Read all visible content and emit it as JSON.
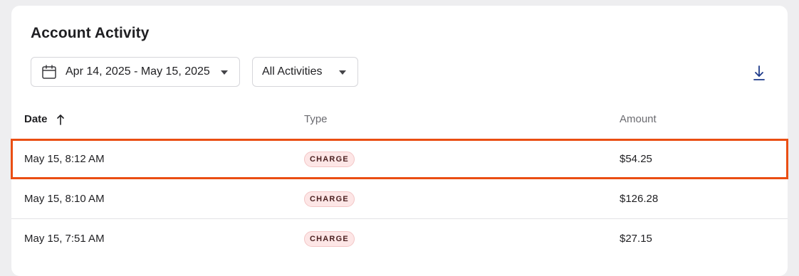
{
  "page": {
    "title": "Account Activity"
  },
  "filters": {
    "date_range": "Apr 14, 2025 - May 15, 2025",
    "activity_type": "All Activities"
  },
  "icons": {
    "calendar": "calendar-icon",
    "caret": "chevron-down-icon",
    "download": "download-icon",
    "sort": "arrow-up-icon"
  },
  "table": {
    "headers": {
      "date": "Date",
      "type": "Type",
      "amount": "Amount"
    },
    "sort": {
      "column": "date",
      "direction": "ascending"
    },
    "rows": [
      {
        "date": "May 15, 8:12 AM",
        "type": "CHARGE",
        "amount": "$54.25",
        "highlighted": true
      },
      {
        "date": "May 15, 8:10 AM",
        "type": "CHARGE",
        "amount": "$126.28",
        "highlighted": false
      },
      {
        "date": "May 15, 7:51 AM",
        "type": "CHARGE",
        "amount": "$27.15",
        "highlighted": false
      }
    ]
  },
  "colors": {
    "highlight_border": "#ea4e13",
    "charge_badge_bg": "#fde6e6",
    "download_icon": "#1d3a8a",
    "page_bg": "#eeeef0"
  }
}
